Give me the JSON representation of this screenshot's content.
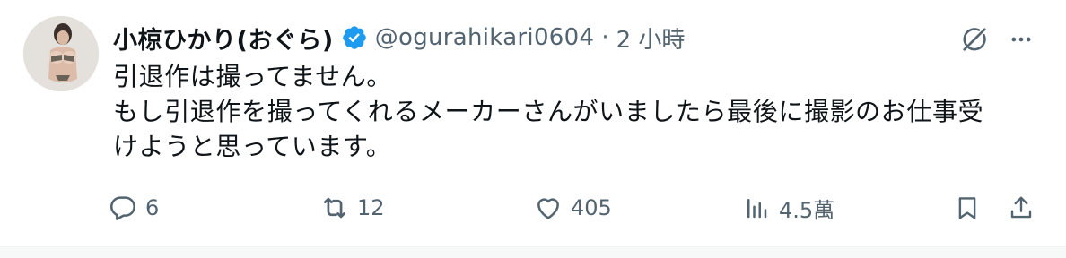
{
  "tweet": {
    "display_name": "小椋ひかり(おぐら)",
    "handle": "@ogurahikari0604",
    "separator": "·",
    "timestamp": "2 小時",
    "lines": [
      "引退作は撮ってません。",
      "もし引退作を撮ってくれるメーカーさんがいましたら最後に撮影のお仕事受",
      "けようと思っています。"
    ]
  },
  "actions": {
    "replies": "6",
    "retweets": "12",
    "likes": "405",
    "views": "4.5萬"
  },
  "icons": {
    "verified": "verified-badge-icon",
    "grok": "grok-icon",
    "more": "more-icon",
    "reply": "reply-icon",
    "retweet": "retweet-icon",
    "like": "like-icon",
    "views": "views-icon",
    "bookmark": "bookmark-icon",
    "share": "share-icon"
  },
  "colors": {
    "text": "#0f1419",
    "secondary": "#536471",
    "verified": "#1d9bf0"
  }
}
